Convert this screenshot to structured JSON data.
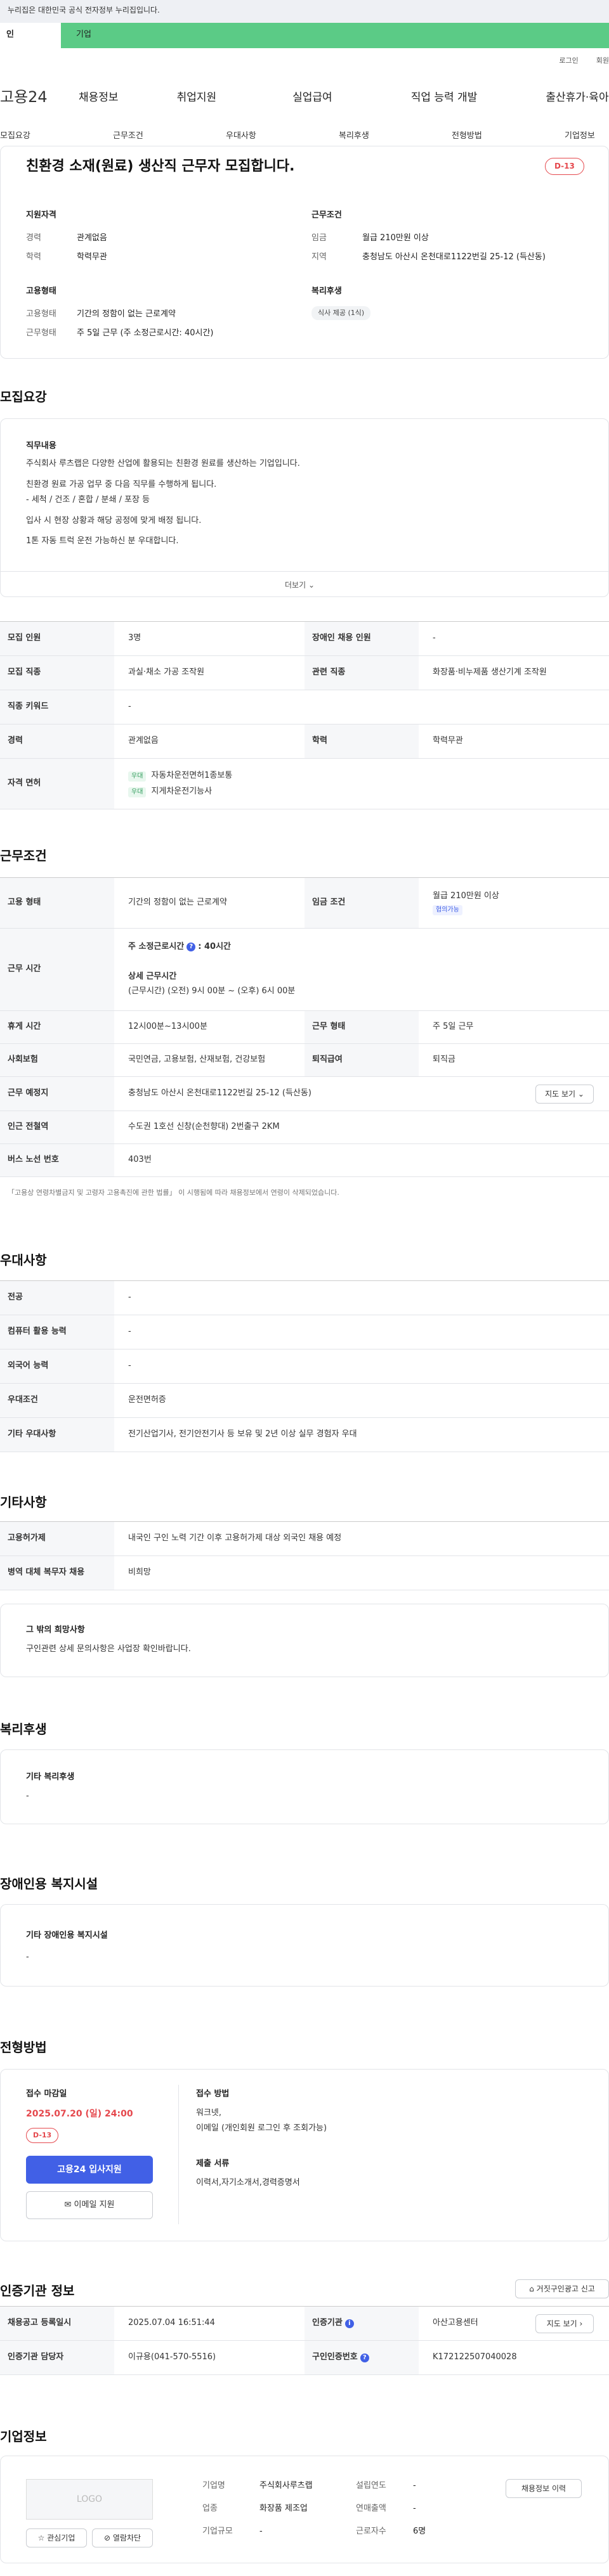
{
  "top_notice": "누리집은 대한민국 공식 전자정부 누리집입니다.",
  "top_tabs": [
    "인",
    "기업"
  ],
  "util_links": [
    "로그인",
    "회원"
  ],
  "logo": "고용24",
  "gnb": [
    "채용정보",
    "취업지원",
    "실업급여",
    "직업 능력 개발",
    "출산휴가·육아휴직"
  ],
  "subnav": [
    "모집요강",
    "근무조건",
    "우대사항",
    "복리후생",
    "전형방법",
    "기업정보"
  ],
  "summary": {
    "title": "친환경 소재(원료) 생산직 근무자 모집합니다.",
    "dday": "D-13",
    "qual_title": "지원자격",
    "qual": [
      {
        "k": "경력",
        "v": "관계없음"
      },
      {
        "k": "학력",
        "v": "학력무관"
      }
    ],
    "work_title": "근무조건",
    "work": [
      {
        "k": "임금",
        "v": "월급 210만원 이상"
      },
      {
        "k": "지역",
        "v": "충청남도 아산시 온천대로1122번길 25-12 (득산동)"
      }
    ],
    "emp_title": "고용형태",
    "emp": [
      {
        "k": "고용형태",
        "v": "기간의 정함이 없는 근로계약"
      },
      {
        "k": "근무형태",
        "v": "주 5일 근무 (주 소정근로시간: 40시간)"
      }
    ],
    "welfare_title": "복리후생",
    "welfare_chip": "식사 제공 (1식)"
  },
  "recruit": {
    "title": "모집요강",
    "job_title": "직무내용",
    "job_lines": [
      "주식회사 루츠랩은 다양한 산업에 활용되는 친환경 원료를 생산하는 기업입니다.",
      "친환경 원료 가공 업무 중 다음 직무를 수행하게 됩니다.",
      "- 세척 / 건조 / 혼합 / 분쇄 / 포장 등",
      "입사 시 현장 상황과 해당 공정에 맞게 배정 됩니다.",
      "1톤 자동 트럭 운전 가능하신 분 우대합니다."
    ],
    "more": "더보기",
    "rows": [
      {
        "k1": "모집 인원",
        "v1": "3명",
        "k2": "장애인 채용 인원",
        "v2": "-"
      },
      {
        "k1": "모집 직종",
        "v1": "과실·채소 가공 조작원",
        "k2": "관련 직종",
        "v2": "화장품·비누제품 생산기계 조작원"
      },
      {
        "k1": "직종 키워드",
        "v1": "-"
      },
      {
        "k1": "경력",
        "v1": "관계없음",
        "k2": "학력",
        "v2": "학력무관"
      }
    ],
    "license_label": "자격 면허",
    "licenses": [
      {
        "tag": "우대",
        "name": "자동차운전면허1종보통"
      },
      {
        "tag": "우대",
        "name": "지게차운전기능사"
      }
    ]
  },
  "conditions": {
    "title": "근무조건",
    "emp_label": "고용 형태",
    "emp_value": "기간의 정함이 없는 근로계약",
    "wage_label": "임금 조건",
    "wage_value": "월급 210만원 이상",
    "wage_tag": "협의가능",
    "hours_label": "근무 시간",
    "hours_main": "주 소정근로시간",
    "hours_main_value": ": 40시간",
    "hours_detail_title": "상세 근무시간",
    "hours_detail": "(근무시간) (오전) 9시 00분 ~ (오후) 6시 00분",
    "break_label": "휴게 시간",
    "break_value": "12시00분~13시00분",
    "shift_label": "근무 형태",
    "shift_value": "주 5일 근무",
    "insurance_label": "사회보험",
    "insurance_value": "국민연금, 고용보험, 산재보험, 건강보험",
    "severance_label": "퇴직급여",
    "severance_value": "퇴직금",
    "place_label": "근무 예정지",
    "place_value": "충청남도 아산시 온천대로1122번길 25-12 (득산동)",
    "map_btn": "지도 보기",
    "station_label": "인근 전철역",
    "station_value": "수도권 1호선 신창(순천향대) 2번출구 2KM",
    "bus_label": "버스 노선 번호",
    "bus_value": "403번",
    "footnote": "「고용상 연령차별금지 및 고령자 고용촉진에 관한 법률」 이 시행됨에 따라 채용정보에서 연령이 삭제되었습니다."
  },
  "preference": {
    "title": "우대사항",
    "rows": [
      {
        "k": "전공",
        "v": "-"
      },
      {
        "k": "컴퓨터 활용 능력",
        "v": "-"
      },
      {
        "k": "외국어 능력",
        "v": "-"
      },
      {
        "k": "우대조건",
        "v": "운전면허증"
      },
      {
        "k": "기타 우대사항",
        "v": "전기산업기사, 전기안전기사 등 보유 및 2년 이상 실무 경험자 우대"
      }
    ]
  },
  "etc": {
    "title": "기타사항",
    "rows": [
      {
        "k": "고용허가제",
        "v": "내국인 구인 노력 기간 이후 고용허가제 대상 외국인 채용 예정"
      },
      {
        "k": "병역 대체 복무자 채용",
        "v": "비희망"
      }
    ],
    "other_title": "그 밖의 희망사항",
    "other_value": "구인관련 상세 문의사항은 사업장 확인바랍니다."
  },
  "welfare": {
    "title": "복리후생",
    "sub": "기타 복리후생",
    "value": "-"
  },
  "disabled": {
    "title": "장애인용 복지시설",
    "sub": "기타 장애인용 복지시설",
    "value": "-"
  },
  "selection": {
    "title": "전형방법",
    "deadline_label": "접수 마감일",
    "deadline": "2025.07.20 (일) 24:00",
    "dday": "D-13",
    "apply_btn": "고용24 입사지원",
    "email_btn": "이메일 지원",
    "method_label": "접수 방법",
    "method_lines": [
      "워크넷,",
      "이메일 (개인회원 로그인 후 조회가능)"
    ],
    "docs_label": "제출 서류",
    "docs_value": "이력서,자기소개서,경력증명서"
  },
  "cert": {
    "title": "인증기관 정보",
    "report_btn": "거짓구인광고 신고",
    "rows": [
      {
        "k1": "채용공고 등록일시",
        "v1": "2025.07.04 16:51:44",
        "k2": "인증기관",
        "v2": "아산고용센터",
        "btn": "지도 보기"
      },
      {
        "k1": "인증기관 담당자",
        "v1": "이규용(041-570-5516)",
        "k2": "구인인증번호",
        "v2": "K172122507040028"
      }
    ]
  },
  "company": {
    "title": "기업정보",
    "logo": "LOGO",
    "fav_btn": "관심기업",
    "block_btn": "열람차단",
    "info_btn": "채용정보 이력",
    "fields": [
      {
        "k": "기업명",
        "v": "주식회사루츠랩"
      },
      {
        "k": "설립연도",
        "v": "-"
      },
      {
        "k": "업종",
        "v": "화장품 제조업"
      },
      {
        "k": "연매출액",
        "v": "-"
      },
      {
        "k": "기업규모",
        "v": "-"
      },
      {
        "k": "근로자수",
        "v": "6명"
      }
    ]
  }
}
